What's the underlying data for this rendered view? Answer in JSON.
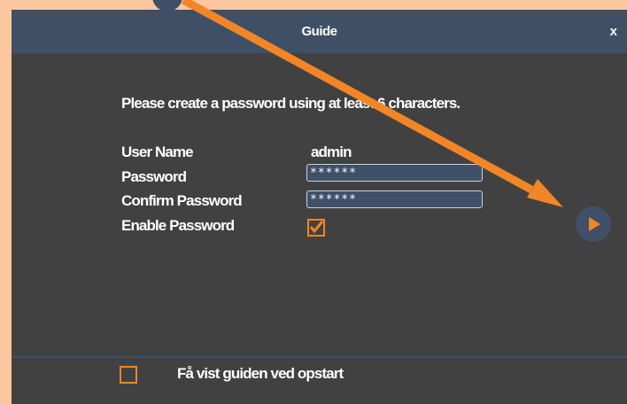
{
  "window": {
    "title": "Guide",
    "close_label": "x"
  },
  "form": {
    "instruction": "Please create a password using at least 6 characters.",
    "user_name_label": "User Name",
    "user_name_value": "admin",
    "password_label": "Password",
    "password_value": "******",
    "confirm_label": "Confirm Password",
    "confirm_value": "******",
    "enable_label": "Enable Password",
    "enable_checked": true
  },
  "footer": {
    "startup_label": "Få vist guiden ved opstart",
    "startup_checked": false
  },
  "colors": {
    "accent": "#f28627",
    "titlebar": "#3f4f66",
    "panel": "#414141",
    "background": "#fbc79e"
  },
  "icons": {
    "next": "play-triangle-icon",
    "annotation": "annotation-arrow"
  }
}
